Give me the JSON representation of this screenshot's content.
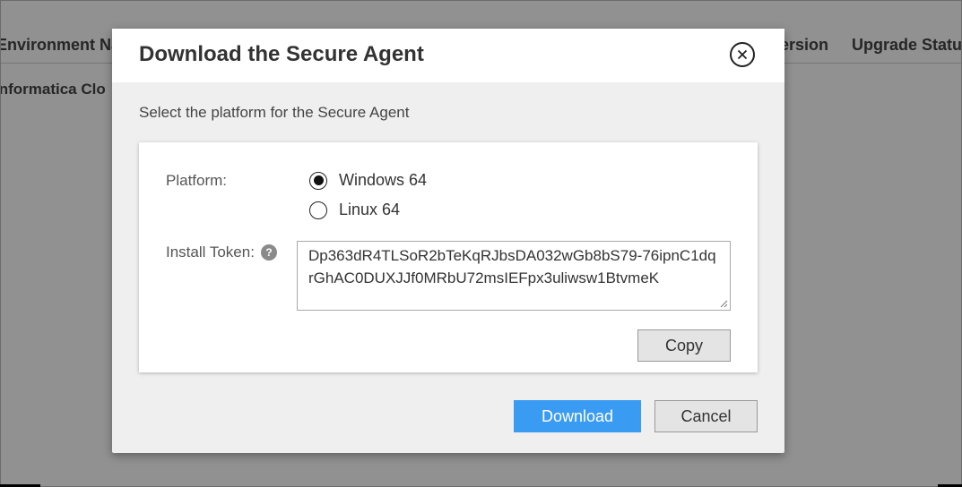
{
  "background": {
    "columns": [
      "Environment Na",
      "ersion",
      "Upgrade Status"
    ],
    "row_cell": "Informatica Clo"
  },
  "dialog": {
    "title": "Download the Secure Agent",
    "subtitle": "Select the platform for the Secure Agent",
    "platform_label": "Platform:",
    "platforms": [
      {
        "label": "Windows 64",
        "selected": true
      },
      {
        "label": "Linux 64",
        "selected": false
      }
    ],
    "token_label": "Install Token:",
    "help_glyph": "?",
    "token_value": "Dp363dR4TLSoR2bTeKqRJbsDA032wGb8bS79-76ipnC1dqrGhAC0DUXJJf0MRbU72msIEFpx3uliwsw1BtvmeK",
    "copy_label": "Copy",
    "download_label": "Download",
    "cancel_label": "Cancel"
  },
  "colors": {
    "primary_button": "#3a9bf2",
    "overlay": "rgba(0,0,0,0.43)"
  },
  "icons": {
    "close": "close-icon",
    "help": "help-icon"
  }
}
